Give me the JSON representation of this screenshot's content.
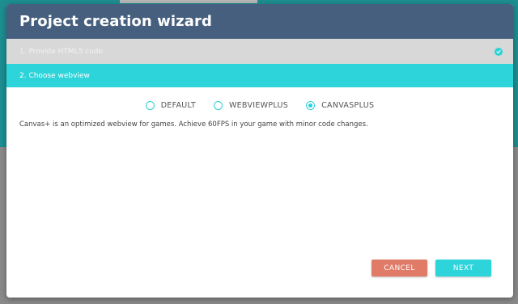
{
  "wizard": {
    "title": "Project creation wizard",
    "steps": [
      {
        "label": "1.  Provide HTML5 code",
        "status": "completed"
      },
      {
        "label": "2.  Choose webview",
        "status": "active"
      }
    ],
    "webview_options": [
      {
        "label": "DEFAULT",
        "selected": false
      },
      {
        "label": "WEBVIEWPLUS",
        "selected": false
      },
      {
        "label": "CANVASPLUS",
        "selected": true
      }
    ],
    "description": "Canvas+ is an optimized webview for games. Achieve 60FPS in your game with minor code changes.",
    "buttons": {
      "cancel_label": "CANCEL",
      "next_label": "NEXT"
    }
  },
  "colors": {
    "header": "#465f7e",
    "accent": "#2dd4d9",
    "cancel": "#e07b68",
    "step_done_bg": "#d8d8d8"
  },
  "icons": {
    "step_done": "check-circle-icon"
  }
}
